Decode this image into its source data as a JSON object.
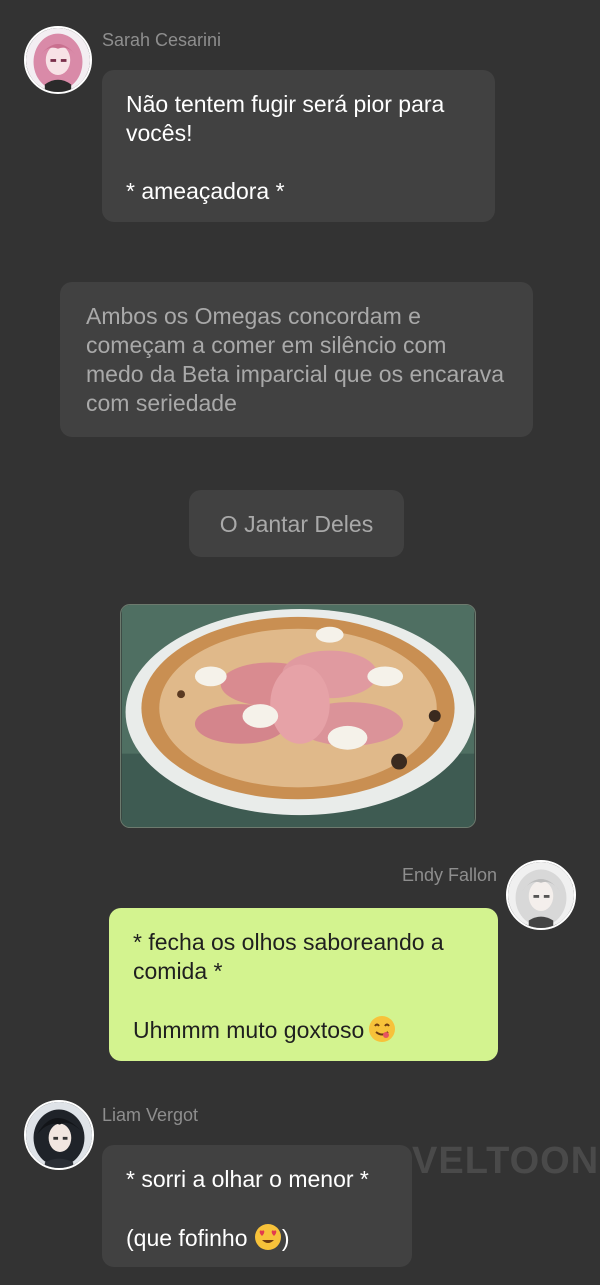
{
  "messages": {
    "sarah": {
      "name": "Sarah Cesarini",
      "text": "Não tentem fugir será pior para vocês!\n\n* ameaçadora *"
    },
    "narration": {
      "text": "Ambos os Omegas concordam e começam a comer em silêncio com medo da Beta imparcial que os encarava com seriedade"
    },
    "title": {
      "text": "O Jantar Deles"
    },
    "endy": {
      "name": "Endy Fallon",
      "text": "* fecha os olhos saboreando a comida *\n\nUhmmm muto goxtoso"
    },
    "liam": {
      "name": "Liam Vergot",
      "line1": "* sorri a olhar o menor *",
      "line2": "(que fofinho ",
      "line2_end": ")"
    }
  },
  "watermark": "VELTOON",
  "icons": {
    "sarah_avatar": "pink-haired-girl-avatar",
    "endy_avatar": "white-haired-girl-avatar",
    "liam_avatar": "black-haired-boy-avatar",
    "endy_emoji": "yum-face-emoji",
    "liam_emoji": "heart-eyes-emoji",
    "photo": "pizza-photo"
  },
  "colors": {
    "background": "#333333",
    "bubble": "#414141",
    "own_bubble": "#d3f38f"
  }
}
